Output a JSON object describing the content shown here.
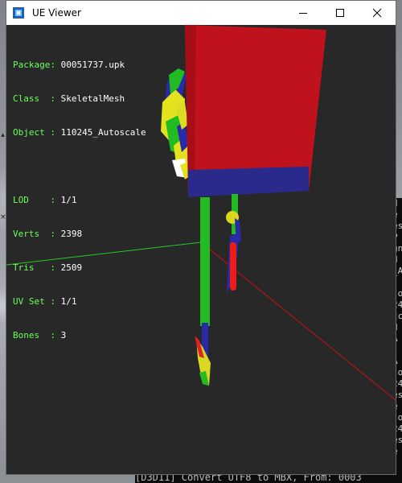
{
  "window": {
    "title": "UE Viewer"
  },
  "info": {
    "package_label": "Package:",
    "package": "00051737.upk",
    "class_label": "Class  :",
    "class": "SkeletalMesh",
    "object_label": "Object :",
    "object": "110245_Autoscale",
    "lod_label": "LOD    :",
    "lod": "1/1",
    "verts_label": "Verts  :",
    "verts": "2398",
    "tris_label": "Tris   :",
    "tris": "2509",
    "uvset_label": "UV Set :",
    "uvset": "1/1",
    "bones_label": "Bones  :",
    "bones": "3"
  },
  "console": {
    "bottom_line": "[D3D11] Convert UTF8 to MBX, From: 0003",
    "right_chars": "d\ne\nes\nP\ngn\nd\n_A\n\n)o\n24\ntc\nd\nA\n\nA\n)o\n24\nes\ne\n)o\n24\nes\ne\n"
  },
  "colors": {
    "viewport_bg": "#282828",
    "info_label": "#6cff5c",
    "info_value": "#ffffff"
  }
}
